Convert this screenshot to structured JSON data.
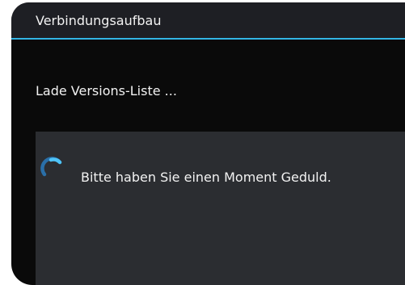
{
  "dialog": {
    "title": "Verbindungsaufbau",
    "status": "Lade Versions-Liste ...",
    "progress": {
      "message": "Bitte haben Sie einen Moment Geduld.",
      "spinner_icon": "loading-spinner-icon"
    }
  },
  "colors": {
    "background": "#0a0a0a",
    "title_bar": "#1e1f24",
    "accent": "#33b5e5",
    "panel": "#2b2d31",
    "text": "#f2f2f2"
  }
}
